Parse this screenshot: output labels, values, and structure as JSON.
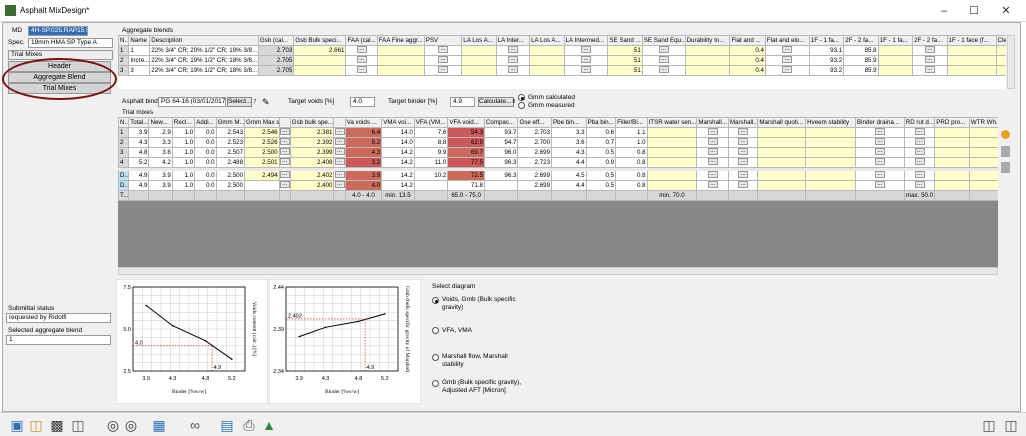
{
  "window": {
    "title": "Asphalt MixDesign*"
  },
  "left": {
    "md_label": "MD",
    "md_value": "4H-SP.025.RAP15 LB",
    "spec_label": "Spec.",
    "spec_value": "19mm HMA SP Type A",
    "trial_mixes_field": "Trial Mixes",
    "nav": [
      "Header",
      "Aggregate Blend",
      "Trial Mixes"
    ],
    "submittal_label": "Submittal status",
    "submittal_value": "requested by Ridolfi",
    "selected_blend_label": "Selected aggregate blend",
    "selected_blend_value": "1"
  },
  "blends": {
    "section": "Aggregate blends",
    "headers": [
      "N...",
      "Name",
      "Description",
      "Gsb (cal...",
      "Gsb Bulk speci...",
      "FAA (cal...",
      "FAA Fine aggr...",
      "PSV",
      "LA Los A...",
      "LA Inter...",
      "LA Los A...",
      "LA Intermed...",
      "SE Sand ...",
      "SE Sand Equ...",
      "Durability In...",
      "Flat and ...",
      "Flat and elo...",
      "1F - 1 fa...",
      "2F - 2 fa...",
      "1F - 1 fa...",
      "2F - 2 fa...",
      "1F - 1 face (f...",
      "Cleane"
    ],
    "rows": [
      {
        "n": "1",
        "name": "1",
        "desc": "22% 3/4\" CR; 20% 1/2\" CR; 19% 3/8...",
        "gsb": "2.703",
        "gsbb": "2.661",
        "se": "51",
        "flat": "0.4",
        "f1": "93.1",
        "f2": "85.8"
      },
      {
        "n": "2",
        "name": "Incre...",
        "desc": "22% 3/4\" CR; 19% 1/2\" CR; 18% 3/8...",
        "gsb": "2.705",
        "gsbb": "",
        "se": "51",
        "flat": "0.4",
        "f1": "93.2",
        "f2": "85.9"
      },
      {
        "n": "3",
        "name": "3",
        "desc": "22% 3/4\" CR; 19% 1/2\" CR; 18% 3/8...",
        "gsb": "2.705",
        "gsbb": "",
        "se": "51",
        "flat": "0.4",
        "f1": "93.2",
        "f2": "85.9"
      }
    ]
  },
  "binder": {
    "label": "Asphalt binder",
    "value": "PG 64-16  (03/01/2017)",
    "select_btn": "Select...",
    "select_num": "7",
    "target_voids_label": "Target voids [%]",
    "target_voids_value": "4.0",
    "target_binder_label": "Target binder [%]",
    "target_binder_value": "4.9",
    "calc_btn": "Calculate...",
    "calc_num": "8",
    "gmm_calc": "Gmm calculated",
    "gmm_meas": "Gmm measured"
  },
  "trials": {
    "section": "Trial mixes",
    "headers": [
      "N...",
      "Total...",
      "New...",
      "Recl...",
      "Addi...",
      "Gmm M...",
      "Gmm Max spe...",
      "",
      "Gsb bulk spe...",
      "",
      "Va voids ...",
      "VMA voi...",
      "VFA (VM...",
      "VFA void...",
      "Compac...",
      "Gse eff...",
      "Pbe bin...",
      "Pba bin...",
      "Filler/Bi...",
      "ITSR water sen...",
      "Marshall...",
      "Marshall...",
      "Marshall quoti...",
      "Hveem stability",
      "Binder draina...",
      "RD rut d...",
      "PRD pro...",
      "WTR Wh...",
      "SIP I"
    ],
    "rows": [
      {
        "n": "1",
        "total": "3.9",
        "new": "2.9",
        "recl": "1.0",
        "addi": "0.0",
        "gmmm": "2.543",
        "gmmmax": "2.546",
        "gsb": "2.381",
        "va": "6.4",
        "vma": "14.0",
        "vfa": "7.6",
        "vfav": "54.3",
        "comp": "93.7",
        "gse": "2.703",
        "pbe": "3.3",
        "pba": "0.6",
        "fil": "1.1",
        "kind": "n"
      },
      {
        "n": "2",
        "total": "4.3",
        "new": "3.3",
        "recl": "1.0",
        "addi": "0.0",
        "gmmm": "2.523",
        "gmmmax": "2.526",
        "gsb": "2.392",
        "va": "5.2",
        "vma": "14.0",
        "vfa": "8.8",
        "vfav": "62.9",
        "comp": "94.7",
        "gse": "2.700",
        "pbe": "3.6",
        "pba": "0.7",
        "fil": "1.0",
        "kind": "n"
      },
      {
        "n": "3",
        "total": "4.8",
        "new": "3.8",
        "recl": "1.0",
        "addi": "0.0",
        "gmmm": "2.507",
        "gmmmax": "2.500",
        "gsb": "2.399",
        "va": "4.3",
        "vma": "14.2",
        "vfa": "9.9",
        "vfav": "69.7",
        "comp": "96.0",
        "gse": "2.699",
        "pbe": "4.3",
        "pba": "0.5",
        "fil": "0.8",
        "kind": "n"
      },
      {
        "n": "4",
        "total": "5.2",
        "new": "4.2",
        "recl": "1.0",
        "addi": "0.0",
        "gmmm": "2.488",
        "gmmmax": "2.501",
        "gsb": "2.408",
        "va": "3.2",
        "vma": "14.2",
        "vfa": "11.0",
        "vfav": "77.5",
        "comp": "96.3",
        "gse": "2.723",
        "pbe": "4.4",
        "pba": "0.9",
        "fil": "0.8",
        "kind": "n"
      },
      {
        "n": "D...",
        "total": "4.9",
        "new": "3.9",
        "recl": "1.0",
        "addi": "0.0",
        "gmmm": "2.500",
        "gmmmax": "2.494",
        "gsb": "2.402",
        "va": "3.9",
        "vma": "14.2",
        "vfa": "10.2",
        "vfav": "72.5",
        "comp": "96.3",
        "gse": "2.699",
        "pbe": "4.5",
        "pba": "0.5",
        "fil": "0.8",
        "kind": "d"
      },
      {
        "n": "D...",
        "total": "4.9",
        "new": "3.9",
        "recl": "1.0",
        "addi": "0.0",
        "gmmm": "2.500",
        "gmmmax": "",
        "gsb": "2.400",
        "va": "4.0",
        "vma": "14.2",
        "vfa": "",
        "vfav": "71.8",
        "comp": "",
        "gse": "2.699",
        "pbe": "4.4",
        "pba": "0.5",
        "fil": "0.8",
        "kind": "d"
      }
    ],
    "limits": {
      "n": "T...",
      "va": "4.0 - 4.0",
      "vma": "min. 13.5",
      "vfa": "65.0 - 75.0",
      "itsr": "min. 70.0",
      "rd": "max. 50.0"
    }
  },
  "diagram": {
    "select_label": "Select diagram",
    "options": [
      "Voids, Gmb (Bulk specific gravity)",
      "VFA, VMA",
      "Marshall flow, Marshall stability",
      "Gmb (Bulk specific gravity), Adjusted AFT [Micron]"
    ]
  },
  "chart_data": [
    {
      "type": "line",
      "xlabel": "Binder [%w/w]",
      "ylabel": "Voids content (calc.) [%]",
      "xticks": [
        "3.9",
        "4.3",
        "4.8",
        "5.2"
      ],
      "yticks": [
        "7.5",
        "5.0",
        "2.5"
      ],
      "xlim": [
        3.7,
        5.4
      ],
      "ylim": [
        2.5,
        7.5
      ],
      "x": [
        3.9,
        4.3,
        4.8,
        5.2
      ],
      "y": [
        6.4,
        5.2,
        4.3,
        3.2
      ],
      "target_label_y": "4.0",
      "target_label_x": "4.9"
    },
    {
      "type": "line",
      "xlabel": "Binder [%w/w]",
      "ylabel": "Gmb (bulk specific gravity of Marshall",
      "xticks": [
        "3.9",
        "4.3",
        "4.8",
        "5.2"
      ],
      "yticks": [
        "2.44",
        "2.39",
        "2.34"
      ],
      "xlim": [
        3.7,
        5.4
      ],
      "ylim": [
        2.34,
        2.44
      ],
      "x": [
        3.9,
        4.3,
        4.8,
        5.2
      ],
      "y": [
        2.381,
        2.392,
        2.399,
        2.408
      ],
      "target_label_y": "2.402",
      "target_label_x": "4.9"
    }
  ]
}
